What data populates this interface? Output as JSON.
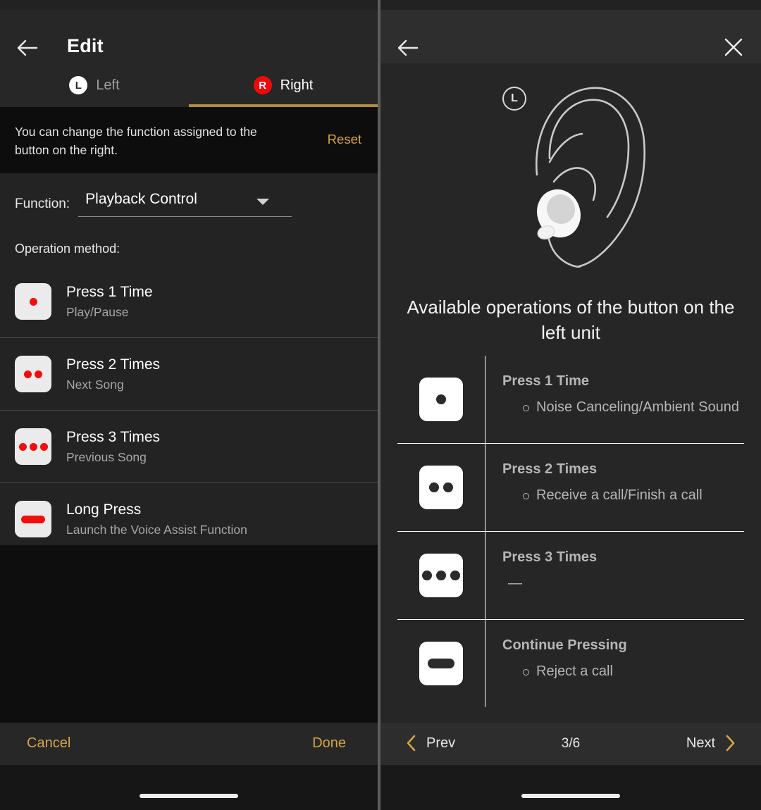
{
  "left_panel": {
    "appbar": {
      "back_icon": "arrow-left-icon",
      "title": "Edit"
    },
    "tabs": [
      {
        "badge": "L",
        "label": "Left",
        "selected": false
      },
      {
        "badge": "R",
        "label": "Right",
        "selected": true
      }
    ],
    "hint": {
      "text": "You can change the function assigned to the button on the right.",
      "reset_label": "Reset"
    },
    "function": {
      "label": "Function:",
      "value": "Playback Control",
      "caret_icon": "chevron-down-icon"
    },
    "operation_method_label": "Operation method:",
    "operations": [
      {
        "icon": "one-dot-icon",
        "dots": 1,
        "title": "Press 1 Time",
        "sub": "Play/Pause"
      },
      {
        "icon": "two-dots-icon",
        "dots": 2,
        "title": "Press 2 Times",
        "sub": "Next Song"
      },
      {
        "icon": "three-dots-icon",
        "dots": 3,
        "title": "Press 3 Times",
        "sub": "Previous Song"
      },
      {
        "icon": "long-bar-icon",
        "dots": 0,
        "title": "Long Press",
        "sub": "Launch the Voice Assist Function"
      }
    ],
    "footer": {
      "cancel_label": "Cancel",
      "done_label": "Done"
    }
  },
  "right_panel": {
    "appbar": {
      "back_icon": "arrow-left-icon",
      "close_icon": "close-icon"
    },
    "illustration": {
      "badge": "L",
      "name": "left-ear-with-earbud-illustration"
    },
    "title": "Available operations of the button on the left unit",
    "table": [
      {
        "icon": "one-dot-icon",
        "dots": 1,
        "title": "Press 1 Time",
        "detail": "Noise Canceling/Ambient Sound",
        "bullet": true
      },
      {
        "icon": "two-dots-icon",
        "dots": 2,
        "title": "Press 2 Times",
        "detail": "Receive a call/Finish a call",
        "bullet": true
      },
      {
        "icon": "three-dots-icon",
        "dots": 3,
        "title": "Press 3 Times",
        "detail": "—",
        "bullet": false
      },
      {
        "icon": "long-bar-icon",
        "dots": 0,
        "title": "Continue Pressing",
        "detail": "Reject a call",
        "bullet": true
      }
    ],
    "footer": {
      "prev_label": "Prev",
      "next_label": "Next",
      "page_counter": "3/6",
      "prev_icon": "chevron-left-icon",
      "next_icon": "chevron-right-icon"
    }
  },
  "colors": {
    "accent_gold": "#d3a544",
    "tab_indicator": "#b08c3f",
    "badge_red": "#ef0909",
    "dot_red": "#f50d0d"
  }
}
